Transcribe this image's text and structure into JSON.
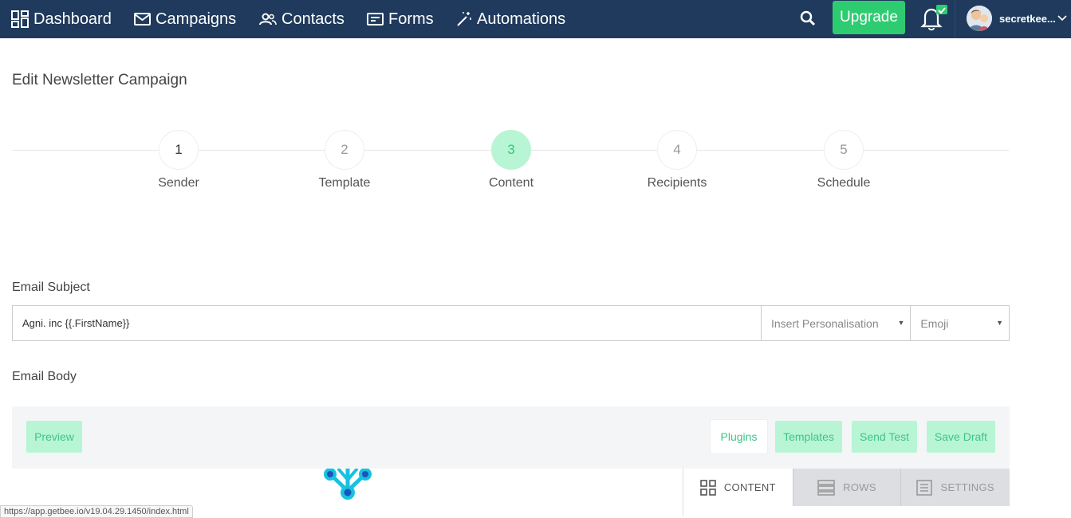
{
  "nav": {
    "items": [
      {
        "label": "Dashboard",
        "icon": "dashboard-icon"
      },
      {
        "label": "Campaigns",
        "icon": "envelope-icon"
      },
      {
        "label": "Contacts",
        "icon": "users-icon"
      },
      {
        "label": "Forms",
        "icon": "form-icon"
      },
      {
        "label": "Automations",
        "icon": "magic-wand-icon"
      }
    ],
    "upgrade_label": "Upgrade",
    "user_name": "secretkee...",
    "colors": {
      "bar": "#1f3a5c",
      "upgrade": "#2ecc71"
    }
  },
  "page": {
    "title": "Edit Newsletter Campaign"
  },
  "stepper": {
    "steps": [
      {
        "number": "1",
        "label": "Sender",
        "state": "done"
      },
      {
        "number": "2",
        "label": "Template",
        "state": "pending"
      },
      {
        "number": "3",
        "label": "Content",
        "state": "active"
      },
      {
        "number": "4",
        "label": "Recipients",
        "state": "pending"
      },
      {
        "number": "5",
        "label": "Schedule",
        "state": "pending"
      }
    ],
    "active_color": "#b8f5d4"
  },
  "subject": {
    "label": "Email Subject",
    "value": "Agni. inc {{.FirstName}}",
    "personalisation_label": "Insert Personalisation",
    "emoji_label": "Emoji"
  },
  "body": {
    "label": "Email Body",
    "toolbar": {
      "preview": "Preview",
      "plugins": "Plugins",
      "templates": "Templates",
      "send_test": "Send Test",
      "save_draft": "Save Draft"
    },
    "side_tabs": {
      "content": "CONTENT",
      "rows": "ROWS",
      "settings": "SETTINGS"
    }
  },
  "status_bar": {
    "url": "https://app.getbee.io/v19.04.29.1450/index.html"
  }
}
